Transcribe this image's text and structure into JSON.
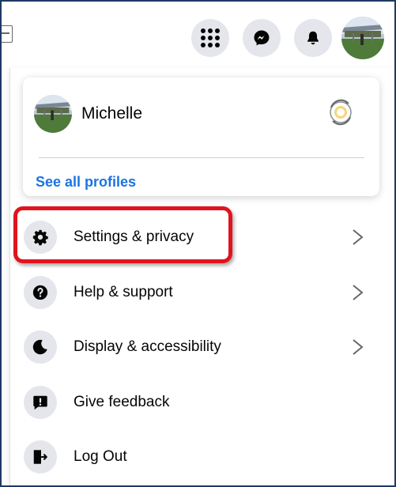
{
  "header": {
    "left_icon": "marketplace-icon",
    "menu_icon": "menu-grid-icon",
    "messenger_icon": "messenger-icon",
    "notifications_icon": "bell-icon",
    "account_avatar": "profile-avatar"
  },
  "profile": {
    "name": "Michelle",
    "switch_icon": "switch-profile-icon",
    "see_all_label": "See all profiles"
  },
  "menu": {
    "items": [
      {
        "label": "Settings & privacy",
        "icon": "gear-icon",
        "has_chevron": true,
        "highlighted": true
      },
      {
        "label": "Help & support",
        "icon": "question-icon",
        "has_chevron": true
      },
      {
        "label": "Display & accessibility",
        "icon": "moon-icon",
        "has_chevron": true
      },
      {
        "label": "Give feedback",
        "icon": "feedback-icon",
        "has_chevron": false
      },
      {
        "label": "Log Out",
        "icon": "logout-icon",
        "has_chevron": false
      }
    ]
  },
  "colors": {
    "accent_link": "#1b74e4",
    "highlight_box": "#e0141e",
    "icon_bg": "#e4e6eb",
    "frame_border": "#1f3864"
  }
}
